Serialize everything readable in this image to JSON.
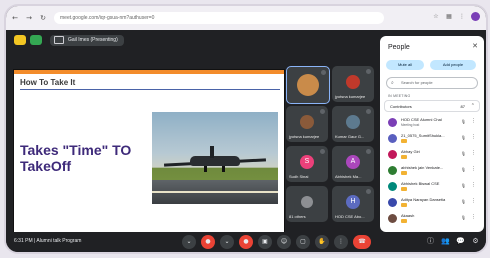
{
  "browser": {
    "back": "←",
    "forward": "→",
    "reload": "↻",
    "address": "meet.google.com/iqr-gsua-nm?authuser=0",
    "icons": [
      "star-icon",
      "extension-icon",
      "menu-icon"
    ]
  },
  "meet_top": {
    "present_label": "Gail Imes (Presenting)"
  },
  "slide": {
    "title": "How To Take It",
    "body": "Takes \"Time\" TO TakeOff"
  },
  "tiles": [
    {
      "name": ""
    },
    {
      "name": "jyotsna kumarjee"
    },
    {
      "name": "jyotsna kumarjee"
    },
    {
      "name": "Kumar Gaur G..."
    },
    {
      "name": "Sudh Sinai",
      "letter": "S"
    },
    {
      "name": "Abhishek Ma...",
      "letter": "A"
    },
    {
      "name": "81 others"
    },
    {
      "name": "HOD CSE Abo...",
      "letter": "H"
    }
  ],
  "bottom": {
    "meeting_info": "6:31 PM | Alumni talk Program",
    "controls": [
      "⌄",
      "●",
      "●",
      "▣",
      "☺",
      "▢",
      "✋",
      "⋮",
      "☎"
    ],
    "right": [
      "ⓘ",
      "👥",
      "💬",
      "⚙"
    ]
  },
  "people": {
    "title": "People",
    "close": "✕",
    "mute_all": "Mute all",
    "add_people": "Add people",
    "search_placeholder": "Search for people",
    "section_label": "IN MEETING",
    "contributors_label": "Contributors",
    "contributors_count": "87",
    "list": [
      {
        "name": "HOD CSE Alumni Chal",
        "sub": "Meeting host",
        "color": "#7b3fb6"
      },
      {
        "name": "21_0575_SumitShukla...",
        "sub": "",
        "color": "#5a5fbf"
      },
      {
        "name": "Abhay Giri",
        "sub": "",
        "color": "#c2185b"
      },
      {
        "name": "abhishek jain Venkate...",
        "sub": "",
        "color": "#2e7d32"
      },
      {
        "name": "Abhishek Biswal CSE",
        "sub": "",
        "color": "#00897b"
      },
      {
        "name": "Aditya Narayan Dansetia",
        "sub": "",
        "color": "#3949ab"
      },
      {
        "name": "Akaash",
        "sub": "",
        "color": "#6d4c41"
      }
    ]
  },
  "colors": {
    "accent_orange": "#f38c2b",
    "slide_text": "#3e2a7a",
    "end_call": "#ea4335"
  }
}
